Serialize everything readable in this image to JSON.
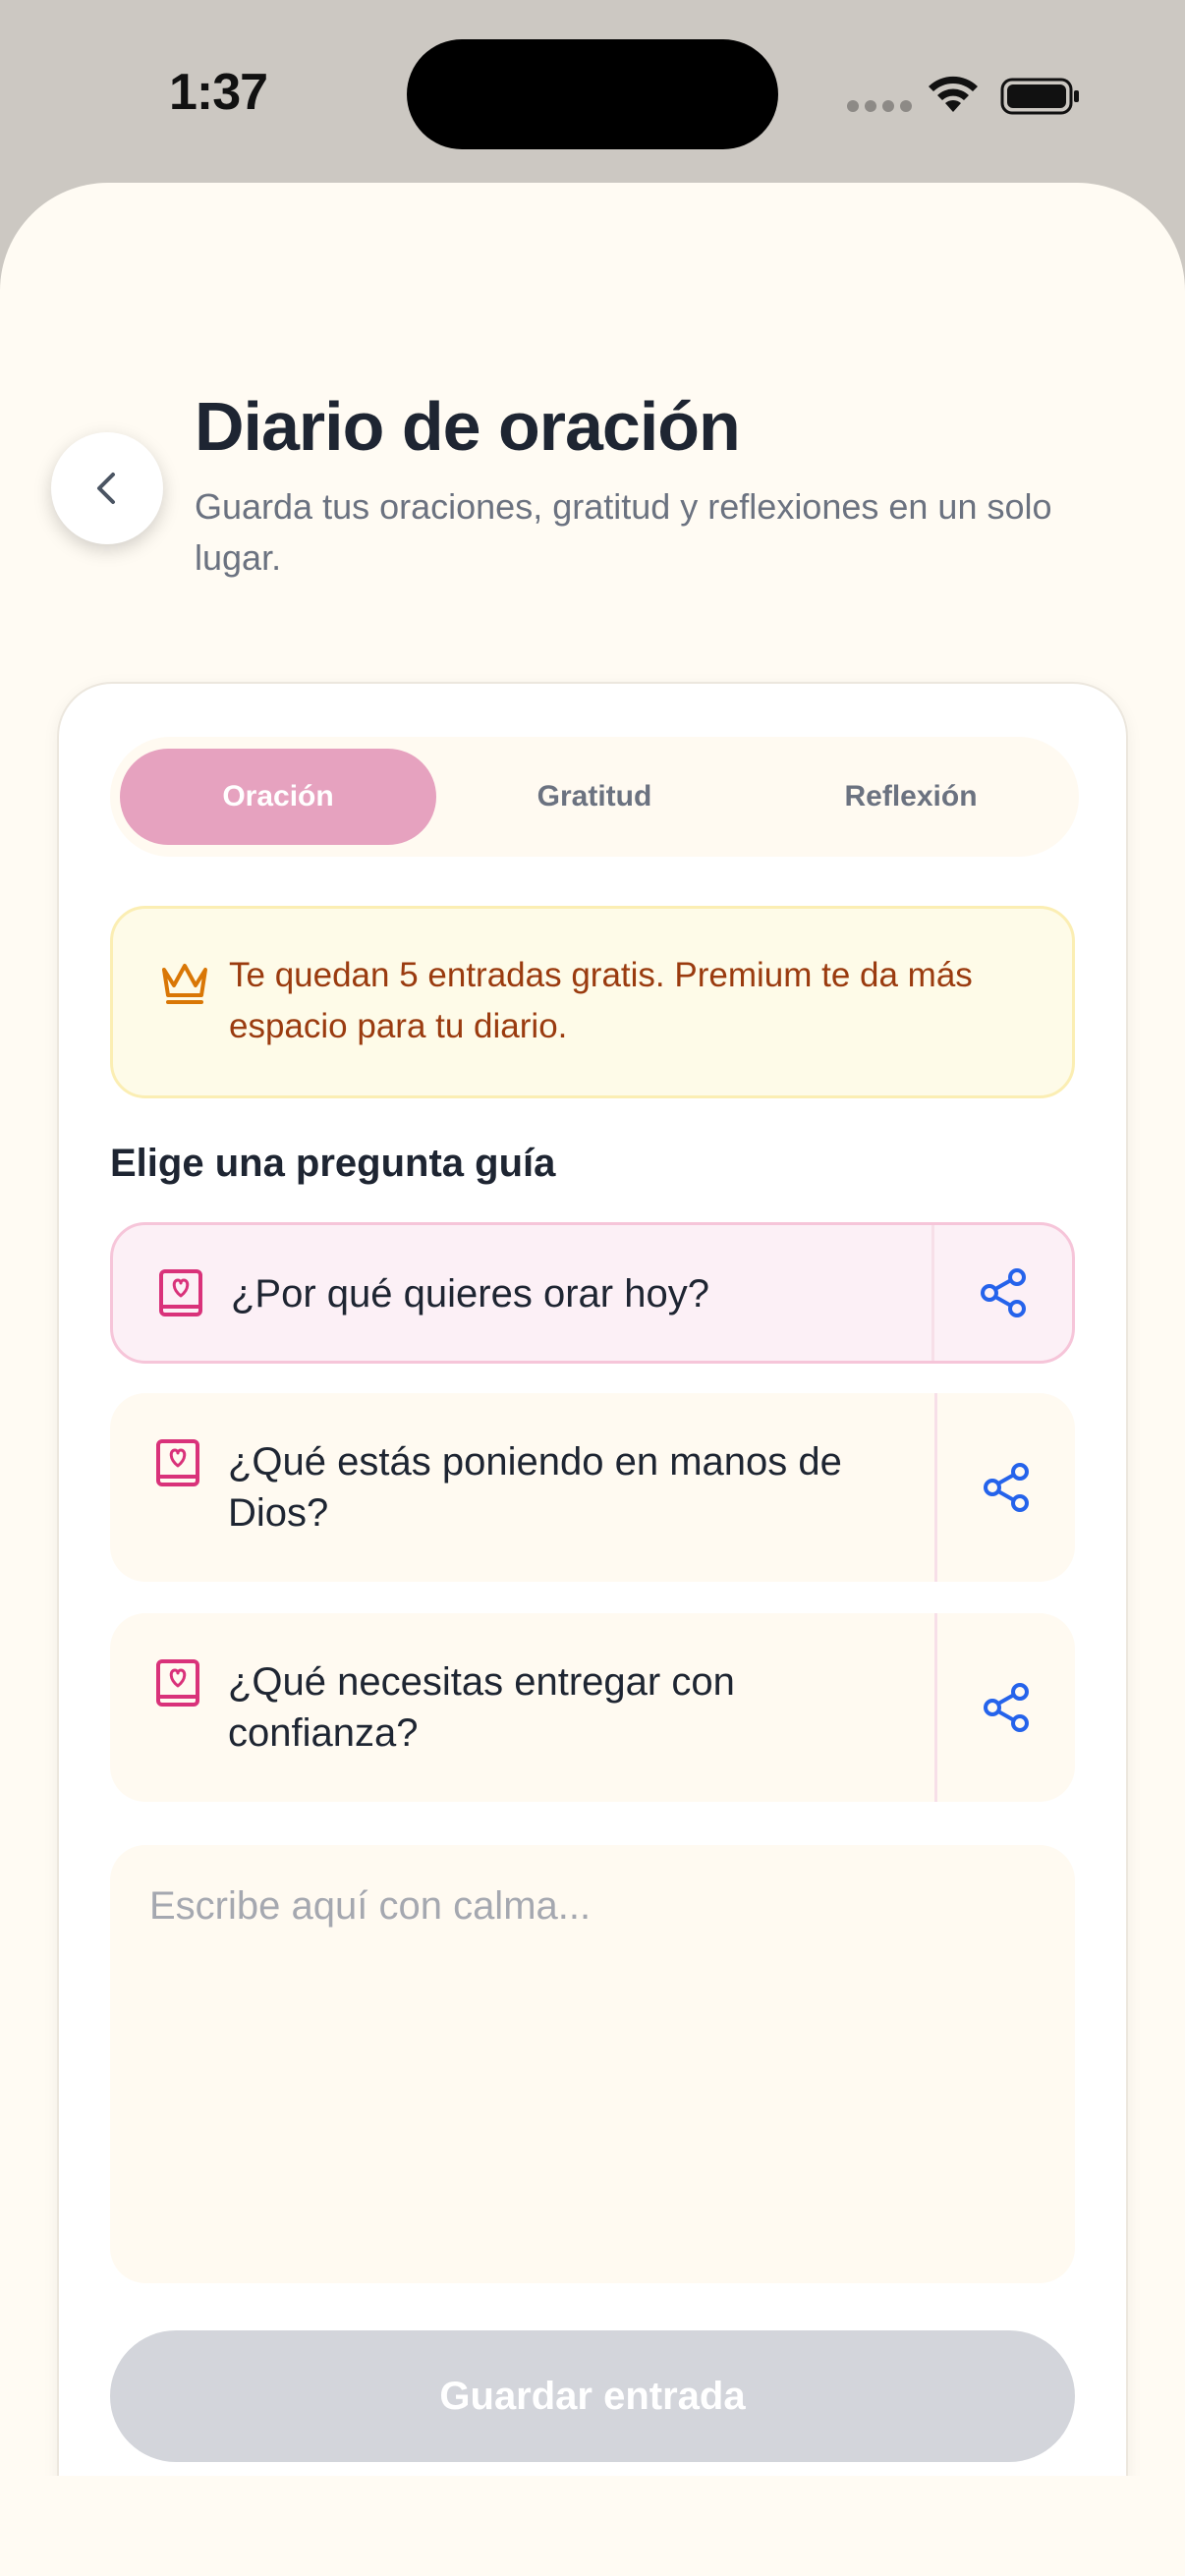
{
  "status_bar": {
    "time": "1:37"
  },
  "header": {
    "title": "Diario de oración",
    "subtitle": "Guarda tus oraciones, gratitud y reflexiones en un solo lugar.",
    "back_icon": "chevron-left-icon"
  },
  "tabs": [
    {
      "label": "Oración",
      "active": true
    },
    {
      "label": "Gratitud",
      "active": false
    },
    {
      "label": "Reflexión",
      "active": false
    }
  ],
  "premium_notice": {
    "icon": "crown-icon",
    "text": "Te quedan 5 entradas gratis. Premium te da más espacio para tu diario."
  },
  "prompts": {
    "heading": "Elige una pregunta guía",
    "items": [
      {
        "text": "¿Por qué quieres orar hoy?",
        "selected": true
      },
      {
        "text": "¿Qué estás poniendo en manos de Dios?",
        "selected": false
      },
      {
        "text": "¿Qué necesitas entregar con confianza?",
        "selected": false
      }
    ]
  },
  "entry": {
    "placeholder": "Escribe aquí con calma..."
  },
  "save_button": {
    "label": "Guardar entrada",
    "enabled": false
  },
  "colors": {
    "accent_pink": "#e6a2bf",
    "icon_pink": "#d9327a",
    "share_blue": "#2563eb",
    "notice_text": "#9a3b0f",
    "crown": "#d97706"
  }
}
